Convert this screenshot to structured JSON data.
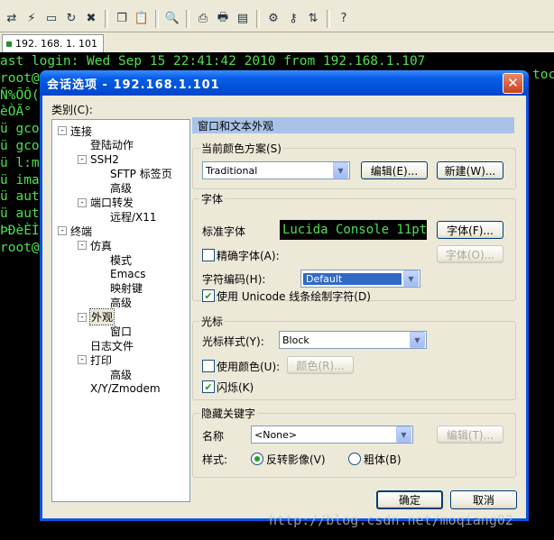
{
  "toolbar": {
    "icons": [
      "connect-icon",
      "quick-connect-icon",
      "new-session-icon",
      "reconnect-icon",
      "disconnect-icon",
      "copy-icon",
      "paste-icon",
      "find-icon",
      "print-setup-icon",
      "print-icon",
      "print-screen-icon",
      "options-icon",
      "key-icon",
      "sftp-icon",
      "help-icon"
    ]
  },
  "tab": {
    "label": "192. 168. 1. 101"
  },
  "terminal": {
    "lines": [
      "ast login: Wed Sep 15 22:41:42 2010 from 192.168.1.107",
      "root@",
      "Ñ%ÕÔ(",
      "èÒÃ°",
      "ü gco",
      "ü gco",
      "ü l:m",
      "ü ima",
      "ü aut",
      "ü aut",
      "ÞÐèÈÌ",
      "root@"
    ],
    "right_fragment": "toc"
  },
  "dialog": {
    "title": "会话选项 - 192.168.1.101",
    "category_label": "类别(C):",
    "tree": [
      {
        "label": "连接",
        "depth": 0,
        "toggle": "-"
      },
      {
        "label": "登陆动作",
        "depth": 1,
        "toggle": ""
      },
      {
        "label": "SSH2",
        "depth": 1,
        "toggle": "-"
      },
      {
        "label": "SFTP 标签页",
        "depth": 2,
        "toggle": ""
      },
      {
        "label": "高级",
        "depth": 2,
        "toggle": ""
      },
      {
        "label": "端口转发",
        "depth": 1,
        "toggle": "-"
      },
      {
        "label": "远程/X11",
        "depth": 2,
        "toggle": ""
      },
      {
        "label": "终端",
        "depth": 0,
        "toggle": "-"
      },
      {
        "label": "仿真",
        "depth": 1,
        "toggle": "-"
      },
      {
        "label": "模式",
        "depth": 2,
        "toggle": ""
      },
      {
        "label": "Emacs",
        "depth": 2,
        "toggle": ""
      },
      {
        "label": "映射键",
        "depth": 2,
        "toggle": ""
      },
      {
        "label": "高级",
        "depth": 2,
        "toggle": ""
      },
      {
        "label": "外观",
        "depth": 1,
        "toggle": "-",
        "selected": true
      },
      {
        "label": "窗口",
        "depth": 2,
        "toggle": ""
      },
      {
        "label": "日志文件",
        "depth": 1,
        "toggle": ""
      },
      {
        "label": "打印",
        "depth": 1,
        "toggle": "-"
      },
      {
        "label": "高级",
        "depth": 2,
        "toggle": ""
      },
      {
        "label": "X/Y/Zmodem",
        "depth": 1,
        "toggle": ""
      }
    ],
    "panel_header": "窗口和文本外观",
    "color_scheme": {
      "group_label": "当前颜色方案(S)",
      "value": "Traditional",
      "edit_button": "编辑(E)...",
      "new_button": "新建(W)..."
    },
    "font": {
      "group_label": "字体",
      "normal_font_label": "标准字体",
      "preview": "Lucida Console 11pt",
      "font_button": "字体(F)...",
      "precise_label": "精确字体(A):",
      "precise_checked": false,
      "precise_font_button": "字体(O)...",
      "encoding_label": "字符编码(H):",
      "encoding_value": "Default",
      "unicode_label": "使用 Unicode 线条绘制字符(D)",
      "unicode_checked": true
    },
    "cursor": {
      "group_label": "光标",
      "style_label": "光标样式(Y):",
      "style_value": "Block",
      "use_color_label": "使用颜色(U):",
      "use_color_checked": false,
      "color_button": "颜色(R)...",
      "blink_label": "闪烁(K)",
      "blink_checked": true
    },
    "hidden_key": {
      "group_label": "隐藏关键字",
      "name_label": "名称",
      "name_value": "<None>",
      "edit_button": "编辑(T)...",
      "style_label": "样式:",
      "reverse_label": "反转影像(V)",
      "bold_label": "粗体(B)",
      "style_selected": "reverse"
    },
    "ok_button": "确定",
    "cancel_button": "取消"
  },
  "watermark": "http://blog.csdn.net/moqiang02"
}
